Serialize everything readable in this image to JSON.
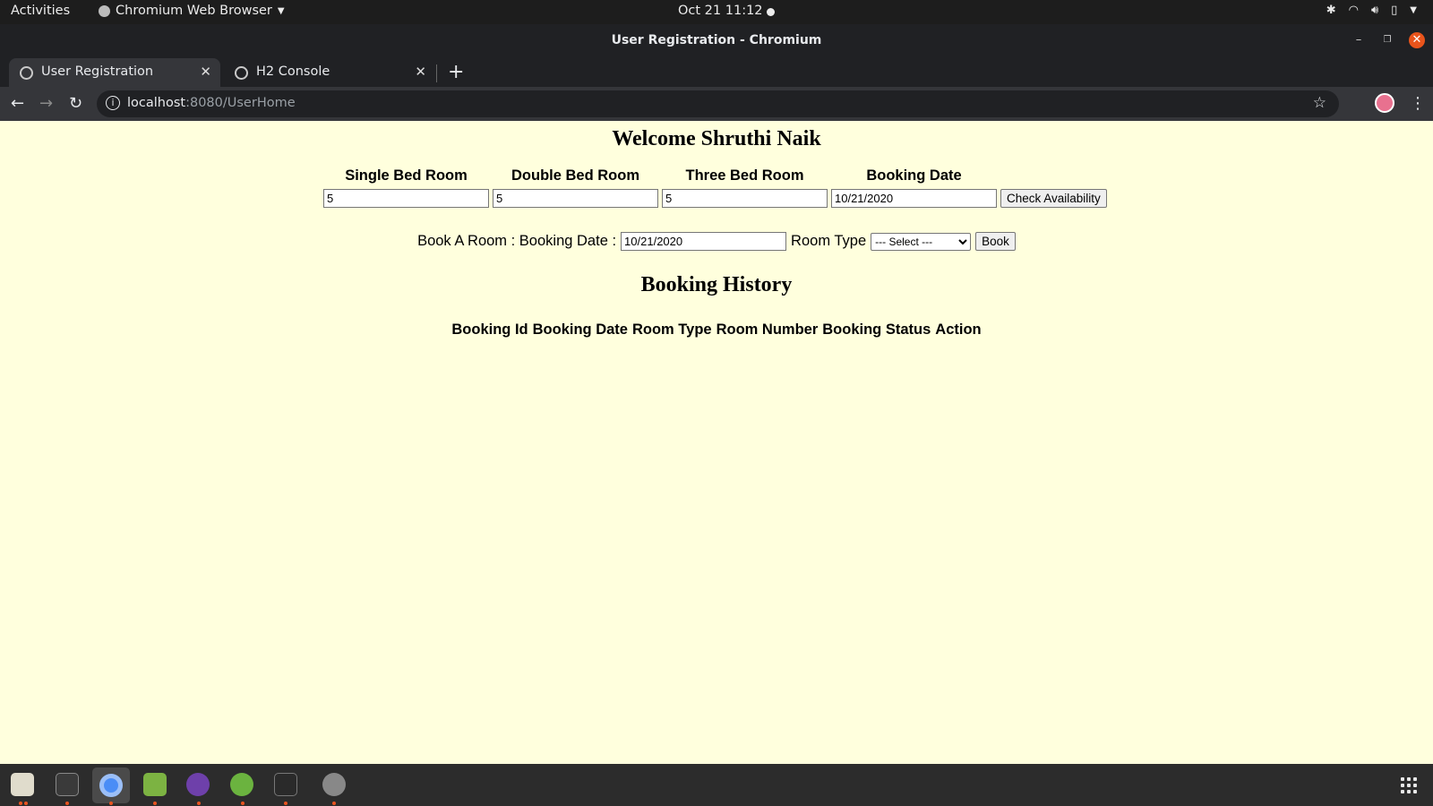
{
  "system_bar": {
    "activities": "Activities",
    "app_menu": "Chromium Web Browser",
    "clock": "Oct 21  11:12"
  },
  "window": {
    "title": "User Registration - Chromium"
  },
  "tabs": [
    {
      "label": "User Registration",
      "active": true
    },
    {
      "label": "H2 Console",
      "active": false
    }
  ],
  "address_bar": {
    "host": "localhost",
    "rest": ":8080/UserHome"
  },
  "page": {
    "heading": "Welcome Shruthi Naik",
    "availability": {
      "single_label": "Single Bed Room",
      "single_value": "5",
      "double_label": "Double Bed Room",
      "double_value": "5",
      "three_label": "Three Bed Room",
      "three_value": "5",
      "date_label": "Booking Date",
      "date_value": "10/21/2020",
      "check_button": "Check Availability"
    },
    "booking": {
      "prefix_label": "Book A Room : Booking Date :",
      "date_value": "10/21/2020",
      "room_type_label": "Room Type",
      "room_type_selected": "--- Select ---",
      "book_button": "Book"
    },
    "history": {
      "heading": "Booking History",
      "columns": [
        "Booking Id",
        "Booking Date",
        "Room Type",
        "Room Number",
        "Booking Status",
        "Action"
      ]
    }
  },
  "dock": {
    "apps": [
      "files-icon",
      "system-monitor-icon",
      "chromium-icon",
      "image-editor-icon",
      "github-desktop-icon",
      "spring-tool-suite-icon",
      "terminal-icon",
      "disk-icon"
    ]
  }
}
